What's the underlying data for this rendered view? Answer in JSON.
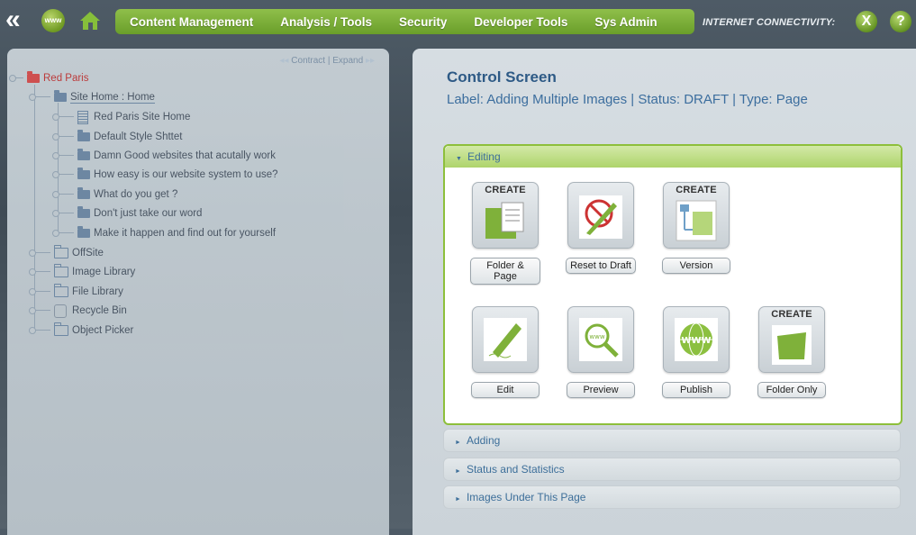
{
  "topbar": {
    "back_icon": "double-chevron-left-icon",
    "www_label": "www",
    "home_icon": "home-icon",
    "nav": [
      "Content Management",
      "Analysis / Tools",
      "Security",
      "Developer Tools",
      "Sys Admin"
    ],
    "connectivity_label": "INTERNET CONNECTIVITY:",
    "close_label": "X",
    "help_label": "?"
  },
  "tree": {
    "contract_label": "Contract",
    "separator": "|",
    "expand_label": "Expand",
    "root": "Red Paris",
    "site_home": "Site Home : Home",
    "children": [
      "Red Paris Site Home",
      "Default Style Shttet",
      "Damn Good websites that acutally work",
      "How easy is our website system to use?",
      "What do you get ?",
      "Don't just take our word",
      "Make it happen and find out for yourself"
    ],
    "others": [
      "OffSite",
      "Image Library",
      "File Library",
      "Recycle Bin",
      "Object Picker"
    ]
  },
  "control": {
    "title": "Control Screen",
    "subtitle": "Label: Adding Multiple Images | Status: DRAFT | Type: Page"
  },
  "sections": {
    "editing": "Editing",
    "adding": "Adding",
    "status": "Status and Statistics",
    "images": "Images Under This Page"
  },
  "tiles": [
    {
      "label": "Folder & Page",
      "create": "CREATE",
      "icon": "folder-page-icon"
    },
    {
      "label": "Reset to Draft",
      "create": "",
      "icon": "reset-draft-icon"
    },
    {
      "label": "Version",
      "create": "CREATE",
      "icon": "version-icon"
    },
    {
      "label": "Edit",
      "create": "",
      "icon": "edit-pen-icon"
    },
    {
      "label": "Preview",
      "create": "",
      "icon": "preview-magnifier-icon"
    },
    {
      "label": "Publish",
      "create": "",
      "icon": "publish-globe-icon"
    },
    {
      "label": "Folder Only",
      "create": "CREATE",
      "icon": "folder-icon"
    }
  ],
  "colors": {
    "accent_green": "#7fb13a",
    "title_blue": "#2e5a86",
    "tree_red": "#d45050"
  }
}
